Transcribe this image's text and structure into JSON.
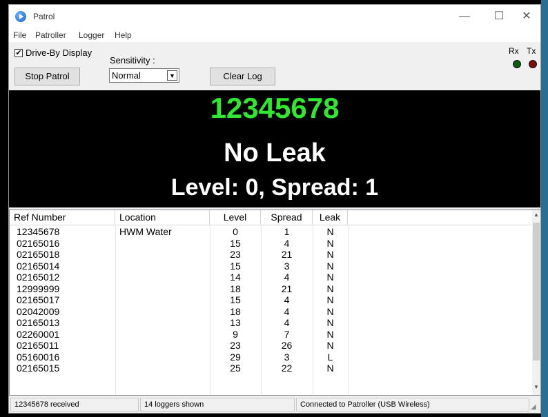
{
  "window": {
    "title": "Patrol",
    "controls": {
      "minimize": "—",
      "maximize": "☐",
      "close": "✕"
    }
  },
  "menu": [
    "File",
    "Patroller",
    "Logger",
    "Help"
  ],
  "toolbar": {
    "drive_by_label": "Drive-By Display",
    "drive_by_checked": "✔",
    "stop_label": "Stop Patrol",
    "sensitivity_label": "Sensitivity :",
    "sensitivity_value": "Normal",
    "clear_label": "Clear Log",
    "rx_label": "Rx",
    "tx_label": "Tx"
  },
  "display": {
    "ref_number": "12345678",
    "status": "No Leak",
    "level_text": "Level: 0, Spread: 1"
  },
  "table": {
    "headers": [
      "Ref Number",
      "Location",
      "Level",
      "Spread",
      "Leak"
    ],
    "rows": [
      [
        "12345678",
        "HWM Water",
        "0",
        "1",
        "N"
      ],
      [
        "02165016",
        "",
        "15",
        "4",
        "N"
      ],
      [
        "02165018",
        "",
        "23",
        "21",
        "N"
      ],
      [
        "02165014",
        "",
        "15",
        "3",
        "N"
      ],
      [
        "02165012",
        "",
        "14",
        "4",
        "N"
      ],
      [
        "12999999",
        "",
        "18",
        "21",
        "N"
      ],
      [
        "02165017",
        "",
        "15",
        "4",
        "N"
      ],
      [
        "02042009",
        "",
        "18",
        "4",
        "N"
      ],
      [
        "02165013",
        "",
        "13",
        "4",
        "N"
      ],
      [
        "02260001",
        "",
        "9",
        "7",
        "N"
      ],
      [
        "02165011",
        "",
        "23",
        "26",
        "N"
      ],
      [
        "05160016",
        "",
        "29",
        "3",
        "L"
      ],
      [
        "02165015",
        "",
        "25",
        "22",
        "N"
      ]
    ]
  },
  "status": {
    "received": "12345678 received",
    "loggers_shown": "14 loggers shown",
    "connection": "Connected to Patroller (USB Wireless)"
  },
  "icons": {
    "scroll_up": "▲",
    "scroll_down": "▼",
    "dropdown": "▼",
    "grip": "◢"
  },
  "colors": {
    "ref_display": "#2fe82f",
    "display_bg": "#000000",
    "rx_led": "#0c5a14",
    "tx_led": "#7a0c0c"
  }
}
